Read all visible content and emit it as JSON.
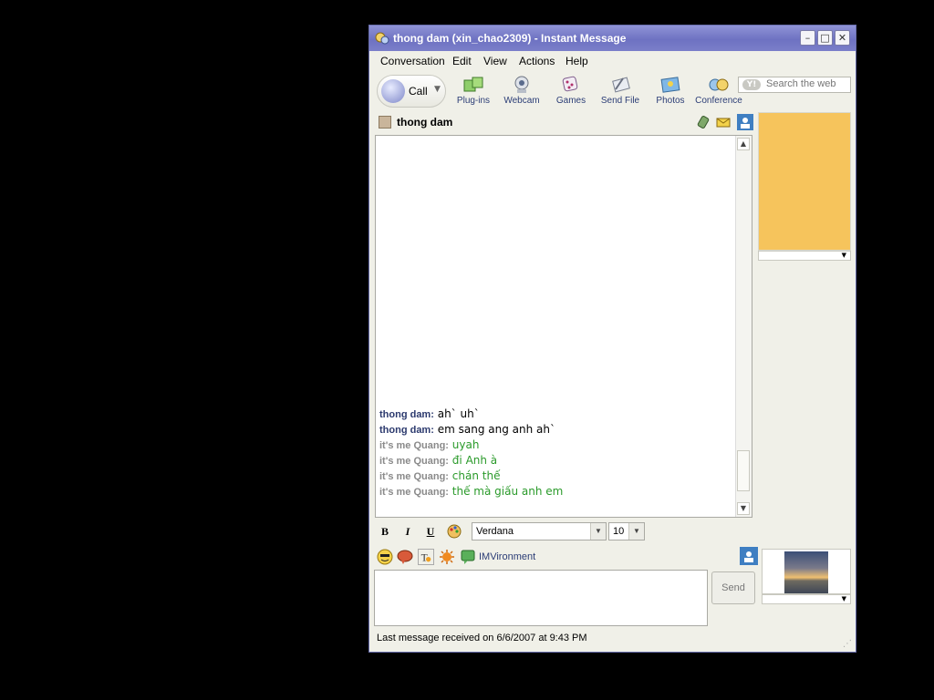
{
  "window": {
    "title": "thong dam (xin_chao2309) - Instant Message",
    "minimize_glyph": "–",
    "maximize_glyph": "□",
    "close_glyph": "✕"
  },
  "menu": [
    "Conversation",
    "Edit",
    "View",
    "Actions",
    "Help"
  ],
  "search": {
    "placeholder": "Search the web",
    "logo": "Y!"
  },
  "toolbar": {
    "call_label": "Call",
    "items": [
      {
        "label": "Plug-ins",
        "icon": "puzzle-icon"
      },
      {
        "label": "Webcam",
        "icon": "webcam-icon"
      },
      {
        "label": "Games",
        "icon": "dice-icon"
      },
      {
        "label": "Send File",
        "icon": "paperclip-file-icon"
      },
      {
        "label": "Photos",
        "icon": "photos-icon"
      },
      {
        "label": "Conference",
        "icon": "conference-icon"
      }
    ]
  },
  "contact": {
    "name": "thong dam"
  },
  "messages": [
    {
      "sender": "thong dam:",
      "text": "ah` uh`",
      "from_me": false
    },
    {
      "sender": "thong dam:",
      "text": "em sang ang anh ah`",
      "from_me": false
    },
    {
      "sender": "it's me Quang:",
      "text": "uyah",
      "from_me": true
    },
    {
      "sender": "it's me Quang:",
      "text": "đi Anh à",
      "from_me": true
    },
    {
      "sender": "it's me Quang:",
      "text": "chán thế",
      "from_me": true
    },
    {
      "sender": "it's me Quang:",
      "text": "thế mà giấu anh em",
      "from_me": true
    }
  ],
  "format": {
    "bold": "B",
    "italic": "I",
    "underline": "U",
    "font": "Verdana",
    "size": "10"
  },
  "emo_bar": {
    "imvironment_label": "IMVironment"
  },
  "send_label": "Send",
  "status": "Last message received on 6/6/2007 at 9:43 PM",
  "colors": {
    "title_bar": "#7a7ec9",
    "my_message_text": "#2a9a2a",
    "their_sender": "#2c3a6e",
    "my_sender": "#8a8a8a",
    "imvironment_panel": "#f6c45c"
  }
}
